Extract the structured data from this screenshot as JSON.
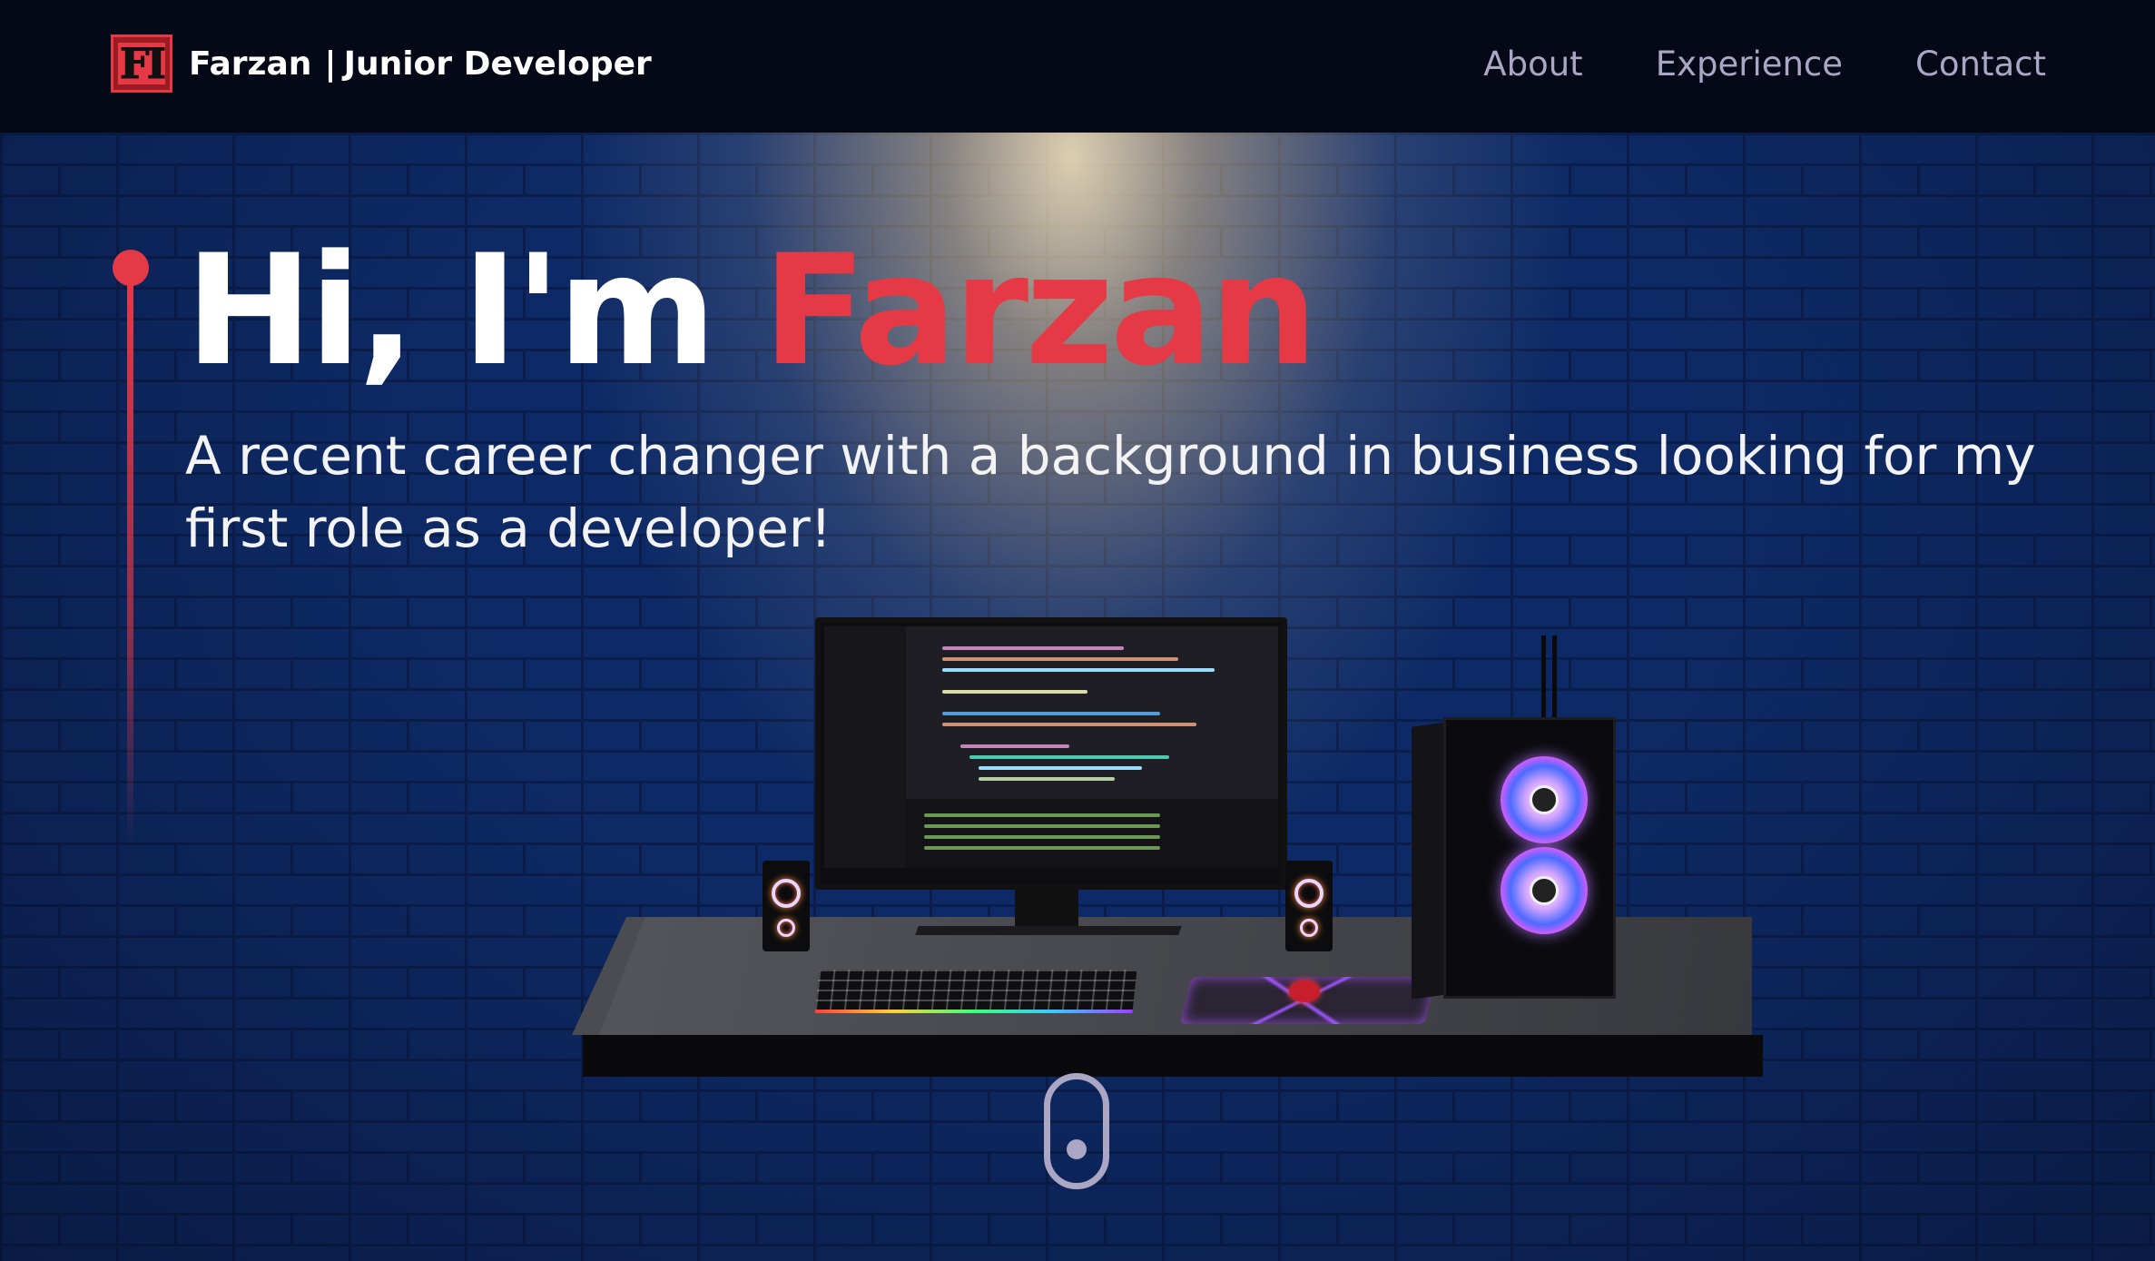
{
  "navbar": {
    "logo_text": "FI",
    "brand_name": "Farzan",
    "brand_separator": "|",
    "brand_role": "Junior Developer",
    "links": [
      {
        "label": "About"
      },
      {
        "label": "Experience"
      },
      {
        "label": "Contact"
      }
    ]
  },
  "hero": {
    "greeting": "Hi, I'm",
    "name": "Farzan",
    "subtitle": "A recent career changer with a background in business looking for my first role as a developer!"
  },
  "colors": {
    "accent": "#e63946",
    "nav_bg": "#050816",
    "nav_text": "#aaa6c3",
    "wall": "#0e2a66"
  },
  "icons": {
    "scroll": "mouse-scroll-icon"
  }
}
